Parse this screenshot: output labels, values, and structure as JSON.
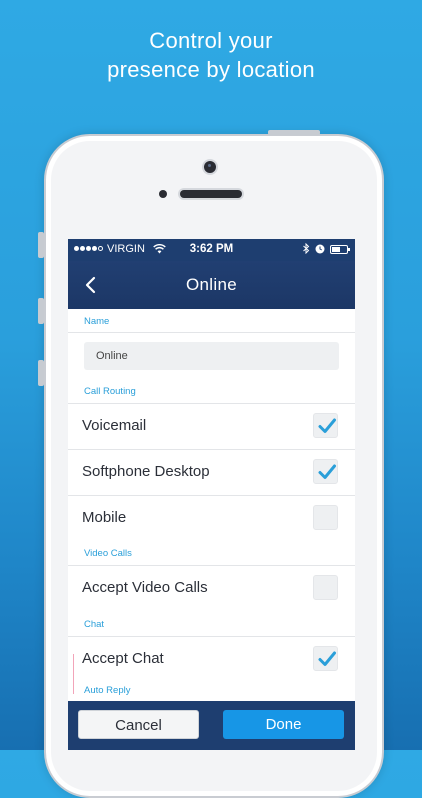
{
  "promo": {
    "line1": "Control your",
    "line2": "presence by location"
  },
  "status_bar": {
    "carrier": "VIRGIN",
    "time": "3:62 PM",
    "battery_level": 0.6
  },
  "nav": {
    "title": "Online"
  },
  "form": {
    "name_label": "Name",
    "name_value": "Online",
    "call_routing_label": "Call Routing",
    "call_routing": [
      {
        "label": "Voicemail",
        "checked": true
      },
      {
        "label": "Softphone Desktop",
        "checked": true
      },
      {
        "label": "Mobile",
        "checked": false
      }
    ],
    "video_calls_label": "Video Calls",
    "video_calls": [
      {
        "label": "Accept Video Calls",
        "checked": false
      }
    ],
    "chat_label": "Chat",
    "chat": [
      {
        "label": "Accept Chat",
        "checked": true
      }
    ],
    "auto_reply_label": "Auto Reply"
  },
  "actions": {
    "cancel": "Cancel",
    "done": "Done"
  },
  "colors": {
    "accent": "#2a9fd9",
    "nav": "#1e3e70",
    "done": "#1796e6"
  }
}
